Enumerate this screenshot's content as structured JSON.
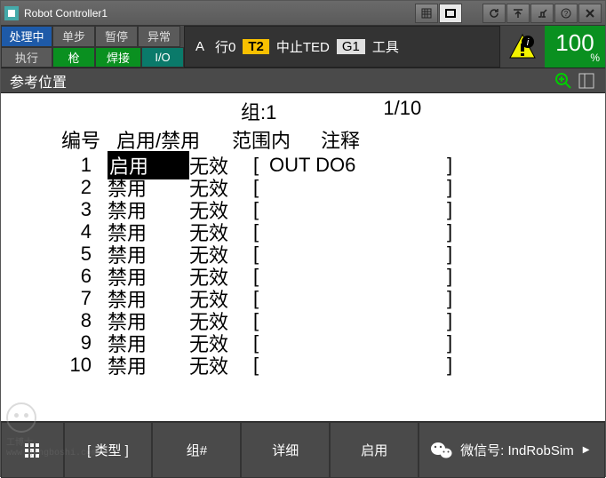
{
  "window": {
    "title": "Robot Controller1"
  },
  "status": {
    "row1": {
      "c1": "处理中",
      "c2": "单步",
      "c3": "暂停",
      "c4": "异常"
    },
    "row2": {
      "c1": "执行",
      "c2": "枪",
      "c3": "焊接",
      "c4": "I/O"
    },
    "mid_a": "A",
    "mid_run": "行0",
    "mid_t2": "T2",
    "mid_stop": "中止TED",
    "mid_g1": "G1",
    "mid_tool": "工具",
    "pct": "100",
    "pct_sym": "%"
  },
  "subheader": {
    "title": "参考位置"
  },
  "group": {
    "label": "组:1",
    "page": "1/10"
  },
  "columns": {
    "num": "编号",
    "enable": "启用/禁用",
    "scope": "范围内",
    "note": "注释"
  },
  "rows": [
    {
      "n": "1",
      "en": "启用",
      "sel": true,
      "scope": "无效",
      "note": "OUT DO6"
    },
    {
      "n": "2",
      "en": "禁用",
      "sel": false,
      "scope": "无效",
      "note": ""
    },
    {
      "n": "3",
      "en": "禁用",
      "sel": false,
      "scope": "无效",
      "note": ""
    },
    {
      "n": "4",
      "en": "禁用",
      "sel": false,
      "scope": "无效",
      "note": ""
    },
    {
      "n": "5",
      "en": "禁用",
      "sel": false,
      "scope": "无效",
      "note": ""
    },
    {
      "n": "6",
      "en": "禁用",
      "sel": false,
      "scope": "无效",
      "note": ""
    },
    {
      "n": "7",
      "en": "禁用",
      "sel": false,
      "scope": "无效",
      "note": ""
    },
    {
      "n": "8",
      "en": "禁用",
      "sel": false,
      "scope": "无效",
      "note": ""
    },
    {
      "n": "9",
      "en": "禁用",
      "sel": false,
      "scope": "无效",
      "note": ""
    },
    {
      "n": "10",
      "en": "禁用",
      "sel": false,
      "scope": "无效",
      "note": ""
    }
  ],
  "footer": {
    "type": "[ 类型 ]",
    "group": "组#",
    "detail": "详细",
    "enable": "启用",
    "wechat": "微信号: IndRobSim"
  },
  "watermark": {
    "brand": "工博士",
    "url": "www.gongboshi.com"
  }
}
